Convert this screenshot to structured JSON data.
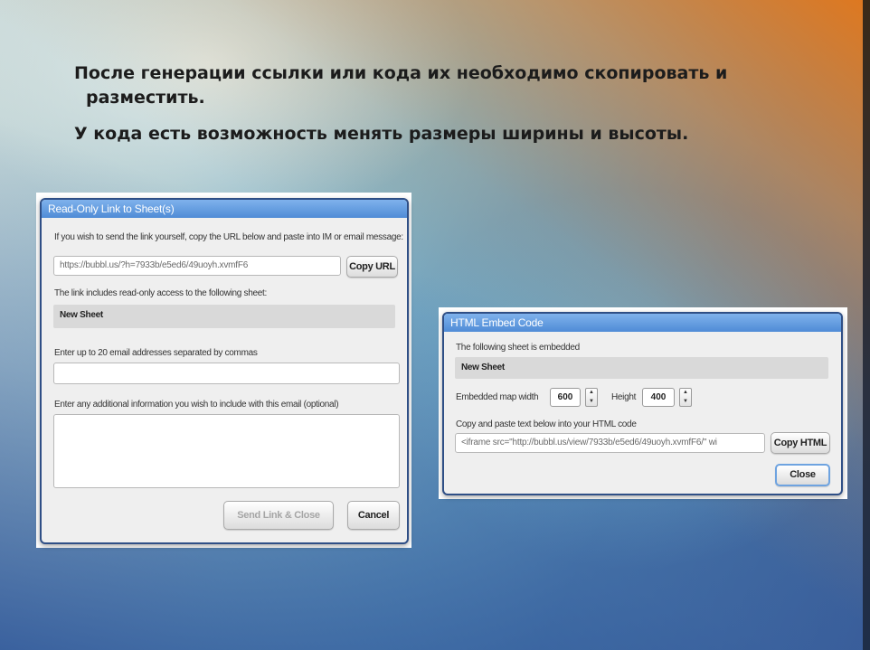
{
  "slide": {
    "line1": "После генерации ссылки или кода их необходимо скопировать и",
    "line2": "разместить.",
    "line3": "У кода есть возможность менять размеры ширины и высоты."
  },
  "readonly_dialog": {
    "title": "Read-Only Link to Sheet(s)",
    "intro": "If you wish to send the link yourself, copy the URL below and paste into IM or email message:",
    "url_value": "https://bubbl.us/?h=7933b/e5ed6/49uoyh.xvmfF6",
    "copy_url_label": "Copy URL",
    "access_note": "The link includes read-only access to the following sheet:",
    "sheet_name": "New Sheet",
    "emails_label": "Enter up to 20 email addresses separated by commas",
    "emails_value": "",
    "message_label": "Enter any additional information you wish to include with this email (optional)",
    "message_value": "",
    "send_label": "Send Link & Close",
    "cancel_label": "Cancel"
  },
  "embed_dialog": {
    "title": "HTML Embed Code",
    "intro": "The following sheet is embedded",
    "sheet_name": "New Sheet",
    "width_label": "Embedded map width",
    "width_value": "600",
    "height_label": "Height",
    "height_value": "400",
    "code_label": "Copy and paste text below into your HTML code",
    "code_value": "<iframe src=\"http://bubbl.us/view/7933b/e5ed6/49uoyh.xvmfF6/\" wi",
    "copy_html_label": "Copy HTML",
    "close_label": "Close"
  }
}
